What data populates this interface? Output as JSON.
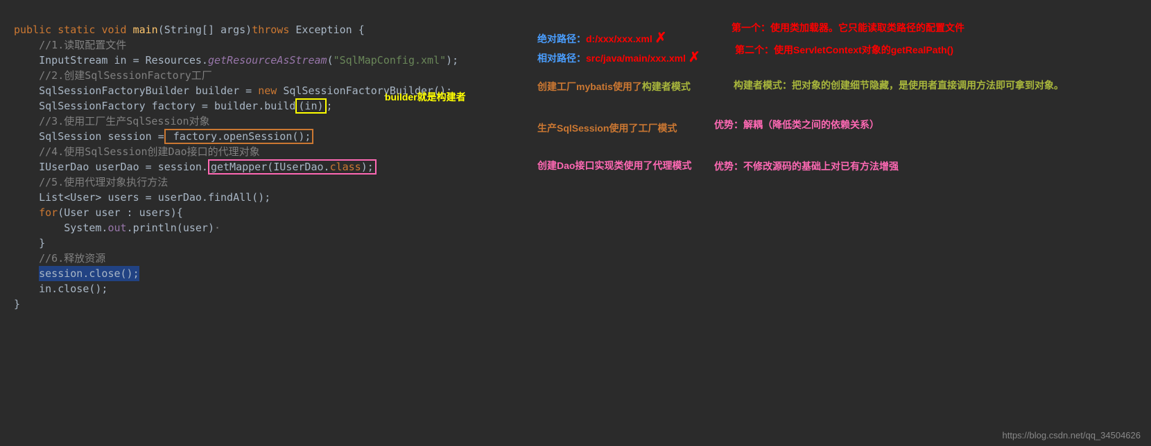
{
  "code": {
    "line1_public": "public",
    "line1_static": "static",
    "line1_void": "void",
    "line1_main": "main",
    "line1_params": "(String[] args)",
    "line1_throws": "throws",
    "line1_exception": "Exception {",
    "comment1": "//1.读取配置文件",
    "line2_type": "InputStream in = Resources.",
    "line2_method": "getResourceAsStream",
    "line2_string": "\"SqlMapConfig.xml\"",
    "line2_end": ");",
    "comment2": "//2.创建SqlSessionFactory工厂",
    "line3": "SqlSessionFactoryBuilder builder = ",
    "line3_new": "new",
    "line3_end": " SqlSessionFactoryBuilder();",
    "line4_a": "SqlSessionFactory factory = builder.build",
    "line4_in": "(in)",
    "line4_semi": ";",
    "comment3": "//3.使用工厂生产SqlSession对象",
    "line5_a": "SqlSession session =",
    "line5_b": " factory.openSession();",
    "comment4": "//4.使用SqlSession创建Dao接口的代理对象",
    "line6_a": "IUserDao userDao = session.",
    "line6_b": "getMapper(IUserDao.",
    "line6_class": "class",
    "line6_end": ");",
    "comment5": "//5.使用代理对象执行方法",
    "line7": "List<User> users = userDao.findAll();",
    "line8_for": "for",
    "line8_rest": "(User user : users){",
    "line9_a": "    System.",
    "line9_out": "out",
    "line9_b": ".println(user)",
    "line9_c": "·",
    "line10": "}",
    "comment6": "//6.释放资源",
    "line11": "session.close();",
    "line12": "in.close();",
    "line13": "}"
  },
  "annotations": {
    "builder_note": "builder就是构建者",
    "abs_path_label": "绝对路径：",
    "abs_path_val": "d:/xxx/xxx.xml",
    "rel_path_label": "相对路径：",
    "rel_path_val": "src/java/main/xxx.xml",
    "first_note": "第一个：使用类加载器。它只能读取类路径的配置文件",
    "second_note": "第二个：使用ServletContext对象的getRealPath()",
    "factory_note_a": "创建工厂mybatis使用了",
    "factory_note_b": "构建者模式",
    "builder_pattern": "构建者模式：把对象的创建细节隐藏，是使用者直接调用方法即可拿到对象。",
    "session_note": "生产SqlSession使用了工厂模式",
    "session_adv": "优势：解耦（降低类之间的依赖关系）",
    "dao_note": "创建Dao接口实现类使用了代理模式",
    "dao_adv": "优势：不修改源码的基础上对已有方法增强"
  },
  "watermark": "https://blog.csdn.net/qq_34504626"
}
